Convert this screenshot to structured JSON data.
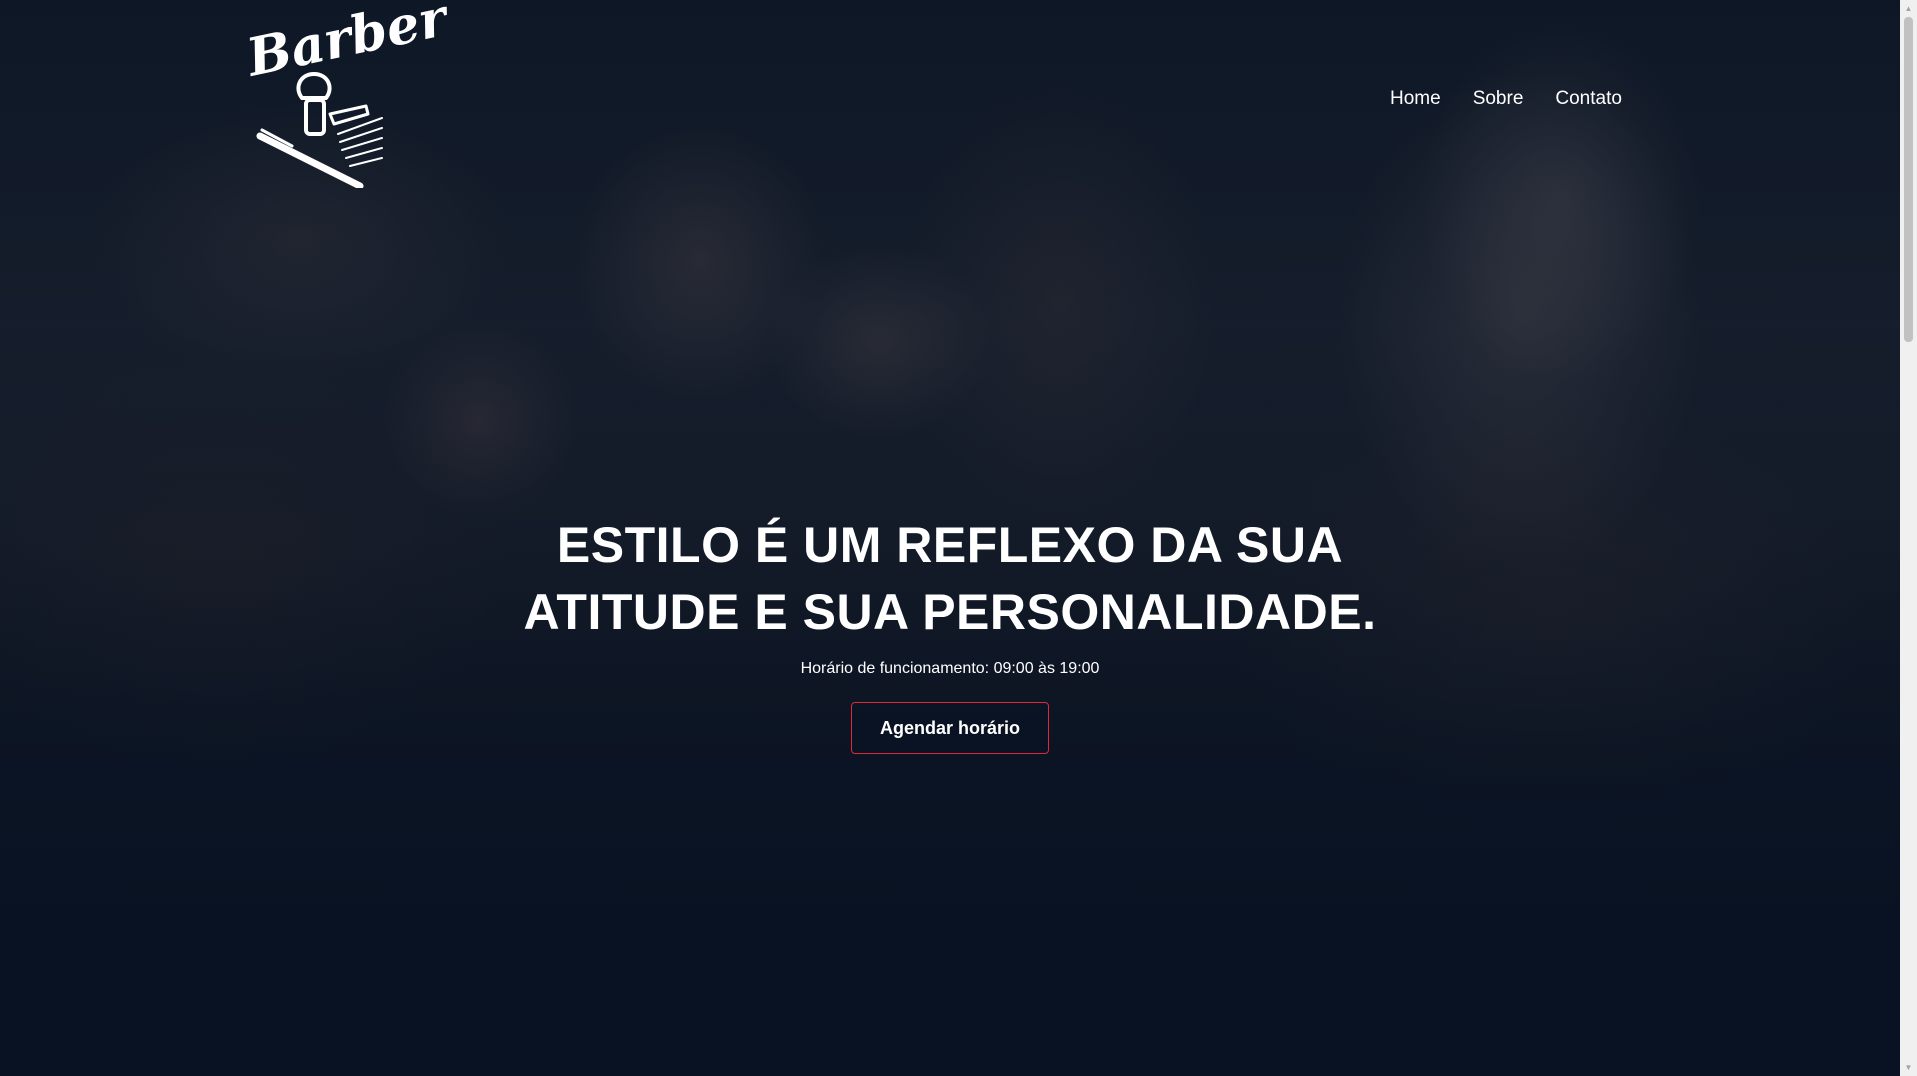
{
  "logo": {
    "text": "Barber",
    "icon": "barber-logo-icon"
  },
  "nav": {
    "items": [
      {
        "label": "Home"
      },
      {
        "label": "Sobre"
      },
      {
        "label": "Contato"
      }
    ]
  },
  "hero": {
    "headline_line1": "ESTILO É UM REFLEXO DA SUA",
    "headline_line2": "ATITUDE E SUA PERSONALIDADE.",
    "hours": "Horário de funcionamento: 09:00 às 19:00",
    "cta_label": "Agendar horário"
  },
  "colors": {
    "background": "#0b1524",
    "accent": "#e0283a",
    "text": "#ffffff"
  }
}
